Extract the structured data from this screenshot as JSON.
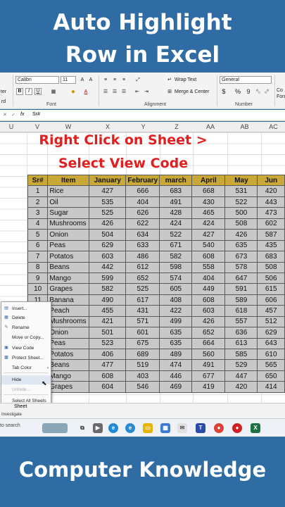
{
  "title": {
    "line1": "Auto Highlight",
    "line2": "Row in Excel"
  },
  "footer_text": "Computer Knowledge",
  "ribbon": {
    "font_name": "Calibri",
    "font_size": "11",
    "wrap_text": "Wrap Text",
    "merge_center": "Merge & Center",
    "number_format": "General",
    "group_font": "Font",
    "group_alignment": "Alignment",
    "group_number": "Number",
    "bold": "B",
    "italic": "I",
    "underline": "U",
    "painter_label": "ter",
    "clipboard_label": "rd",
    "cond_label": "Co",
    "formatting_label": "Forma",
    "currency": "$",
    "percent": "%",
    "comma": "9"
  },
  "formula_bar": {
    "fx": "fx",
    "value": "Sr#"
  },
  "columns": [
    "U",
    "V",
    "W",
    "X",
    "Y",
    "Z",
    "AA",
    "AB",
    "AC"
  ],
  "instruction": {
    "line1": "Right Click on Sheet >",
    "line2": "Select View Code"
  },
  "table": {
    "headers": [
      "Sr#",
      "Item",
      "January",
      "February",
      "march",
      "April",
      "May",
      "Jun"
    ],
    "rows": [
      [
        "1",
        "Rice",
        "427",
        "666",
        "683",
        "668",
        "531",
        "420"
      ],
      [
        "2",
        "Oil",
        "535",
        "404",
        "491",
        "430",
        "522",
        "443"
      ],
      [
        "3",
        "Sugar",
        "525",
        "626",
        "428",
        "465",
        "500",
        "473"
      ],
      [
        "4",
        "Mushrooms",
        "426",
        "622",
        "424",
        "424",
        "508",
        "602"
      ],
      [
        "5",
        "Onion",
        "504",
        "634",
        "522",
        "427",
        "426",
        "587"
      ],
      [
        "6",
        "Peas",
        "629",
        "633",
        "671",
        "540",
        "635",
        "435"
      ],
      [
        "7",
        "Potatos",
        "603",
        "486",
        "582",
        "608",
        "673",
        "683"
      ],
      [
        "8",
        "Beans",
        "442",
        "612",
        "598",
        "558",
        "578",
        "508"
      ],
      [
        "9",
        "Mango",
        "599",
        "652",
        "574",
        "404",
        "647",
        "506"
      ],
      [
        "10",
        "Grapes",
        "582",
        "525",
        "605",
        "449",
        "591",
        "615"
      ],
      [
        "11",
        "Banana",
        "490",
        "617",
        "408",
        "608",
        "589",
        "606"
      ],
      [
        "12",
        "Peach",
        "455",
        "431",
        "422",
        "603",
        "618",
        "457"
      ],
      [
        "13",
        "Mushrooms",
        "421",
        "571",
        "499",
        "426",
        "557",
        "512"
      ],
      [
        "14",
        "Onion",
        "501",
        "601",
        "635",
        "652",
        "636",
        "629"
      ],
      [
        "15",
        "Peas",
        "523",
        "675",
        "635",
        "664",
        "613",
        "643"
      ],
      [
        "16",
        "Potatos",
        "406",
        "689",
        "489",
        "560",
        "585",
        "610"
      ],
      [
        "17",
        "Beans",
        "477",
        "519",
        "474",
        "491",
        "529",
        "565"
      ],
      [
        "18",
        "Mango",
        "608",
        "403",
        "446",
        "677",
        "447",
        "650"
      ],
      [
        "19",
        "Grapes",
        "604",
        "546",
        "469",
        "419",
        "420",
        "414"
      ]
    ]
  },
  "context_menu": {
    "items": [
      {
        "label": "Insert...",
        "icon": "insert-icon",
        "disabled": false
      },
      {
        "label": "Delete",
        "icon": "delete-icon",
        "disabled": false
      },
      {
        "label": "Rename",
        "icon": "rename-icon",
        "disabled": false
      },
      {
        "label": "Move or Copy...",
        "icon": "",
        "disabled": false
      },
      {
        "label": "View Code",
        "icon": "view-code-icon",
        "disabled": false
      },
      {
        "label": "Protect Sheet...",
        "icon": "protect-sheet-icon",
        "disabled": false
      },
      {
        "label": "Tab Color",
        "icon": "",
        "disabled": false,
        "submenu": true
      },
      {
        "label": "Hide",
        "icon": "",
        "disabled": false
      },
      {
        "label": "Unhide...",
        "icon": "",
        "disabled": true
      },
      {
        "label": "Select All Sheets",
        "icon": "",
        "disabled": false
      }
    ]
  },
  "sheet_tab": "Sheet",
  "status": "Investigate",
  "taskbar": {
    "search": "to search"
  },
  "colors": {
    "banner": "#2f6ca3",
    "header_fill": "#c9a838",
    "row_fill": "#c8c8c8",
    "instruction": "#e02020"
  }
}
